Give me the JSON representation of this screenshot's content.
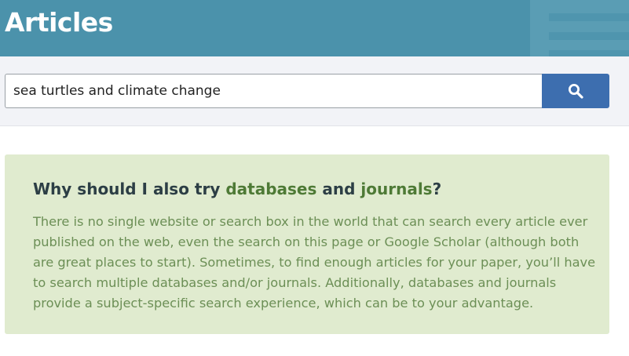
{
  "header": {
    "title": "Articles"
  },
  "search": {
    "value": "sea turtles and climate change",
    "button_icon": "search-icon"
  },
  "callout": {
    "heading": {
      "part1": "Why should I also try ",
      "kw1": "databases",
      "part2": " and ",
      "kw2": "journals",
      "part3": "?"
    },
    "body": "There is no single website or search box in the world that can search every article ever published on the web, even the search on this page or Google Scholar (although both are great places to start). Sometimes, to find enough articles for your paper, you’ll have to search multiple databases and/or journals. Additionally, databases and journals provide a subject-specific search experience, which can be to your advantage."
  },
  "colors": {
    "header_bg": "#4b92ab",
    "search_button_bg": "#3d6eaf",
    "callout_bg": "#e0ebcf",
    "callout_link": "#4e7a36",
    "callout_text": "#6c8f56"
  }
}
